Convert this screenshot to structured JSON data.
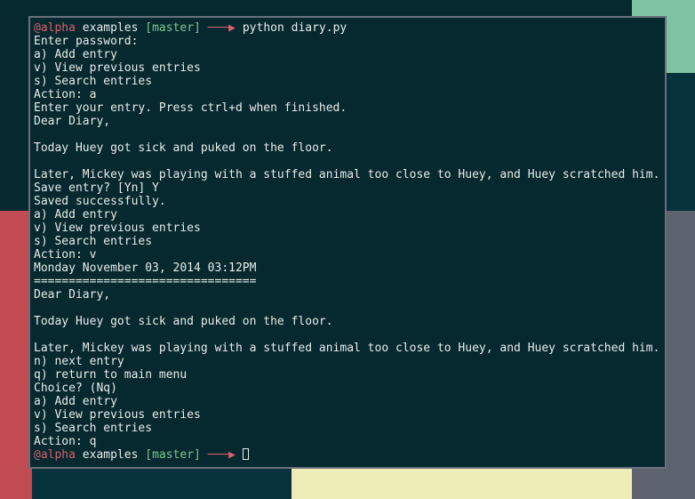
{
  "desktop": {
    "background_color": "#06282f",
    "panels": [
      {
        "name": "green-panel-top-right",
        "color": "#7fc3a2"
      },
      {
        "name": "teal-panel-upper-right",
        "color": "#06323c"
      },
      {
        "name": "gray-panel-right",
        "color": "#5d6470"
      },
      {
        "name": "red-panel-left",
        "color": "#c04b51"
      },
      {
        "name": "red-panel-bottom-left",
        "color": "#c04b51"
      },
      {
        "name": "teal-panel-bottom",
        "color": "#06323c"
      },
      {
        "name": "yellow-panel-bottom",
        "color": "#eeedb8"
      },
      {
        "name": "gray-panel-bottom-right",
        "color": "#5d6470"
      }
    ]
  },
  "terminal": {
    "background_color": "#06282f",
    "border_color": "#6a717d",
    "foreground_color": "#e8ece9",
    "prompt": {
      "user": "@alpha",
      "user_color": "#d9606a",
      "directory": "examples",
      "branch": "[master]",
      "branch_color": "#7fc98a",
      "arrow": "───▶",
      "arrow_color": "#d9606a"
    },
    "lines": [
      {
        "type": "prompt",
        "command": "python diary.py"
      },
      {
        "type": "text",
        "text": "Enter password:"
      },
      {
        "type": "text",
        "text": "a) Add entry"
      },
      {
        "type": "text",
        "text": "v) View previous entries"
      },
      {
        "type": "text",
        "text": "s) Search entries"
      },
      {
        "type": "text",
        "text": "Action: a"
      },
      {
        "type": "text",
        "text": "Enter your entry. Press ctrl+d when finished."
      },
      {
        "type": "text",
        "text": "Dear Diary,"
      },
      {
        "type": "text",
        "text": ""
      },
      {
        "type": "text",
        "text": "Today Huey got sick and puked on the floor."
      },
      {
        "type": "text",
        "text": ""
      },
      {
        "type": "text",
        "text": "Later, Mickey was playing with a stuffed animal too close to Huey, and Huey scratched him."
      },
      {
        "type": "text",
        "text": "Save entry? [Yn] Y"
      },
      {
        "type": "text",
        "text": "Saved successfully."
      },
      {
        "type": "text",
        "text": "a) Add entry"
      },
      {
        "type": "text",
        "text": "v) View previous entries"
      },
      {
        "type": "text",
        "text": "s) Search entries"
      },
      {
        "type": "text",
        "text": "Action: v"
      },
      {
        "type": "text",
        "text": "Monday November 03, 2014 03:12PM"
      },
      {
        "type": "text",
        "text": "================================"
      },
      {
        "type": "text",
        "text": "Dear Diary,"
      },
      {
        "type": "text",
        "text": ""
      },
      {
        "type": "text",
        "text": "Today Huey got sick and puked on the floor."
      },
      {
        "type": "text",
        "text": ""
      },
      {
        "type": "text",
        "text": "Later, Mickey was playing with a stuffed animal too close to Huey, and Huey scratched him."
      },
      {
        "type": "text",
        "text": "n) next entry"
      },
      {
        "type": "text",
        "text": "q) return to main menu"
      },
      {
        "type": "text",
        "text": "Choice? (Nq)"
      },
      {
        "type": "text",
        "text": "a) Add entry"
      },
      {
        "type": "text",
        "text": "v) View previous entries"
      },
      {
        "type": "text",
        "text": "s) Search entries"
      },
      {
        "type": "text",
        "text": "Action: q"
      },
      {
        "type": "prompt",
        "command": ""
      }
    ]
  }
}
